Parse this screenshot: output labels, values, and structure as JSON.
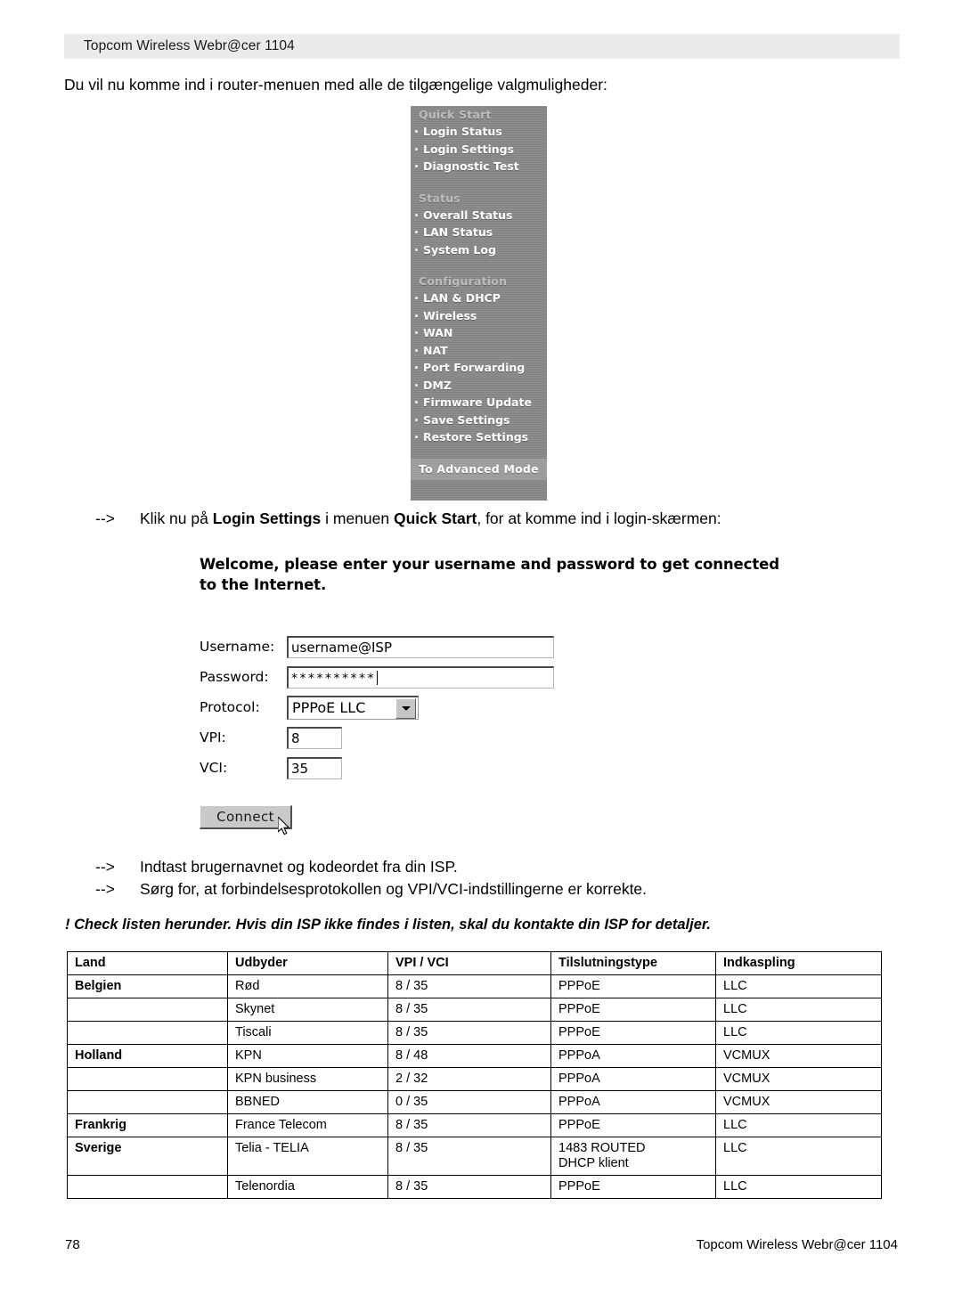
{
  "page": {
    "running_header": "Topcom Wireless Webr@cer 1104",
    "footer_page_number": "78",
    "footer_title": "Topcom Wireless Webr@cer 1104"
  },
  "intro": {
    "text": "Du vil nu komme ind i router-menuen med alle de tilgængelige valgmuligheder:"
  },
  "router_menu": {
    "groups": [
      {
        "title": "Quick Start",
        "items": [
          "Login Status",
          "Login Settings",
          "Diagnostic Test"
        ]
      },
      {
        "title": "Status",
        "items": [
          "Overall Status",
          "LAN Status",
          "System Log"
        ]
      },
      {
        "title": "Configuration",
        "items": [
          "LAN & DHCP",
          "Wireless",
          "WAN",
          "NAT",
          "Port Forwarding",
          "DMZ",
          "Firmware Update",
          "Save Settings",
          "Restore Settings"
        ]
      }
    ],
    "advanced_link": "To Advanced Mode"
  },
  "steps": {
    "arrow": "-->",
    "step1": {
      "part1": "Klik nu på ",
      "bold1": "Login Settings",
      "part2": " i menuen ",
      "bold2": "Quick Start",
      "part3": ", for at komme ind i login-skærmen:"
    },
    "step2": "Indtast brugernavnet og kodeordet fra din ISP.",
    "step3": "Sørg for, at forbindelsesprotokollen og VPI/VCI-indstillingerne er korrekte."
  },
  "login_screen": {
    "welcome": "Welcome, please enter your username and password to get connected to the Internet.",
    "labels": {
      "username": "Username:",
      "password": "Password:",
      "protocol": "Protocol:",
      "vpi": "VPI:",
      "vci": "VCI:"
    },
    "values": {
      "username": "username@ISP",
      "password_mask": "**********",
      "protocol": "PPPoE LLC",
      "vpi": "8",
      "vci": "35"
    },
    "connect_button": "Connect"
  },
  "warning": {
    "text": "! Check listen herunder. Hvis din ISP ikke findes i listen, skal du kontakte din ISP for detaljer."
  },
  "isp_table": {
    "headers": [
      "Land",
      "Udbyder",
      "VPI / VCI",
      "Tilslutningstype",
      "Indkaspling"
    ],
    "rows": [
      {
        "land": "Belgien",
        "land_bold": true,
        "udbyder": "Rød",
        "vpivci": "8 / 35",
        "type": "PPPoE",
        "type_sub": "",
        "indkapsling": "LLC"
      },
      {
        "land": "",
        "land_bold": false,
        "udbyder": "Skynet",
        "vpivci": "8 / 35",
        "type": "PPPoE",
        "type_sub": "",
        "indkapsling": "LLC"
      },
      {
        "land": "",
        "land_bold": false,
        "udbyder": "Tiscali",
        "vpivci": "8 / 35",
        "type": "PPPoE",
        "type_sub": "",
        "indkapsling": "LLC"
      },
      {
        "land": "Holland",
        "land_bold": true,
        "udbyder": "KPN",
        "vpivci": "8 / 48",
        "type": "PPPoA",
        "type_sub": "",
        "indkapsling": "VCMUX"
      },
      {
        "land": "",
        "land_bold": false,
        "udbyder": "KPN business",
        "vpivci": "2 / 32",
        "type": "PPPoA",
        "type_sub": "",
        "indkapsling": "VCMUX"
      },
      {
        "land": "",
        "land_bold": false,
        "udbyder": "BBNED",
        "vpivci": "0 / 35",
        "type": "PPPoA",
        "type_sub": "",
        "indkapsling": "VCMUX"
      },
      {
        "land": "Frankrig",
        "land_bold": true,
        "udbyder": "France Telecom",
        "vpivci": "8 / 35",
        "type": "PPPoE",
        "type_sub": "",
        "indkapsling": "LLC"
      },
      {
        "land": "Sverige",
        "land_bold": true,
        "udbyder": "Telia - TELIA",
        "vpivci": "8 / 35",
        "type": "1483 ROUTED",
        "type_sub": "DHCP klient",
        "indkapsling": "LLC"
      },
      {
        "land": "",
        "land_bold": false,
        "udbyder": "Telenordia",
        "vpivci": "8 / 35",
        "type": "PPPoE",
        "type_sub": "",
        "indkapsling": "LLC"
      }
    ]
  }
}
